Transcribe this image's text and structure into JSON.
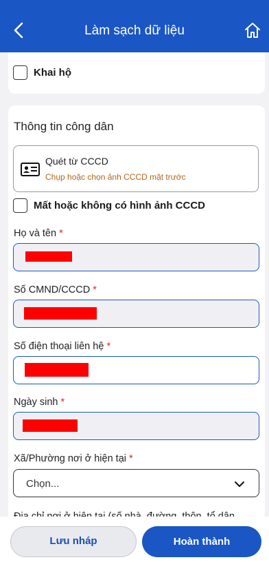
{
  "header": {
    "title": "Làm sạch dữ liệu"
  },
  "top_card": {
    "checkbox_label": "Khai hộ"
  },
  "citizen_section": {
    "title": "Thông tin công dân",
    "scan": {
      "title": "Quét từ CCCD",
      "subtitle": "Chụp hoặc chọn ảnh CCCD mặt trước"
    },
    "missing_checkbox_label": "Mất hoặc không có hình ảnh CCCD",
    "fields": [
      {
        "label": "Họ và tên",
        "required_mark": "*"
      },
      {
        "label": "Số CMND/CCCD",
        "required_mark": "*"
      },
      {
        "label": "Số điện thoại liên hệ",
        "required_mark": "*"
      },
      {
        "label": "Ngày sinh",
        "required_mark": "*"
      },
      {
        "label": "Xã/Phường nơi ở hiện tại",
        "required_mark": "*"
      }
    ],
    "ward_select": {
      "value": "Chọn..."
    },
    "address_label_partial": "Địa chỉ nơi ở hiện tại (số nhà, đường, thôn, tổ dân"
  },
  "actions": {
    "draft_label": "Lưu nháp",
    "done_label": "Hoàn thành"
  },
  "colors": {
    "header": "#1a56c4",
    "redaction": "#ff0000",
    "subtitle": "#b3651a",
    "required": "#e02525"
  },
  "icons": [
    "back-arrow-icon",
    "home-icon",
    "id-card-icon",
    "chevron-down-icon"
  ]
}
